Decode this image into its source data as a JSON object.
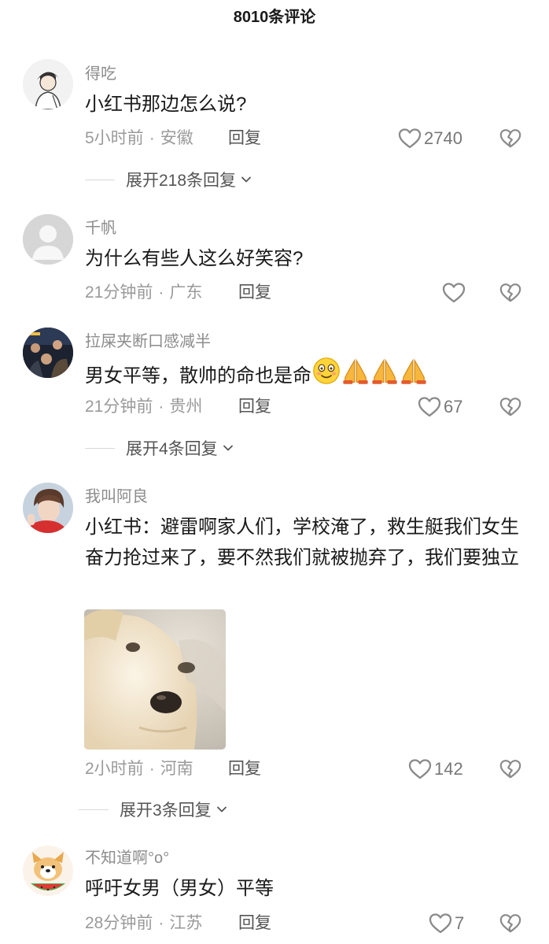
{
  "header": {
    "title": "8010条评论"
  },
  "comments": [
    {
      "username": "得吃",
      "text": "小红书那边怎么说?",
      "time": "5小时前",
      "location": "安徽",
      "reply": "回复",
      "likes": "2740",
      "expand": "展开218条回复"
    },
    {
      "username": "千帆",
      "text": "为什么有些人这么好笑容?",
      "time": "21分钟前",
      "location": "广东",
      "reply": "回复",
      "likes": ""
    },
    {
      "username": "拉屎夹断口感减半",
      "text": "男女平等，散帅的命也是命",
      "emojis": [
        "smiling-face",
        "folded-hands",
        "folded-hands",
        "folded-hands"
      ],
      "time": "21分钟前",
      "location": "贵州",
      "reply": "回复",
      "likes": "67",
      "expand": "展开4条回复"
    },
    {
      "username": "我叫阿良",
      "text": "小红书：避雷啊家人们，学校淹了，救生艇我们女生奋力抢过来了，要不然我们就被抛弃了，我们要独立",
      "time": "2小时前",
      "location": "河南",
      "reply": "回复",
      "likes": "142",
      "expand": "展开3条回复"
    },
    {
      "username": "不知道啊°o°",
      "text": "呼吁女男（男女）平等",
      "time": "28分钟前",
      "location": "江苏",
      "reply": "回复",
      "likes": "7"
    }
  ],
  "colors": {
    "meta_gray": "#9a9a9a",
    "username_gray": "#8c8c8c",
    "text": "#1a1a1a",
    "icon_gray": "#888888"
  }
}
